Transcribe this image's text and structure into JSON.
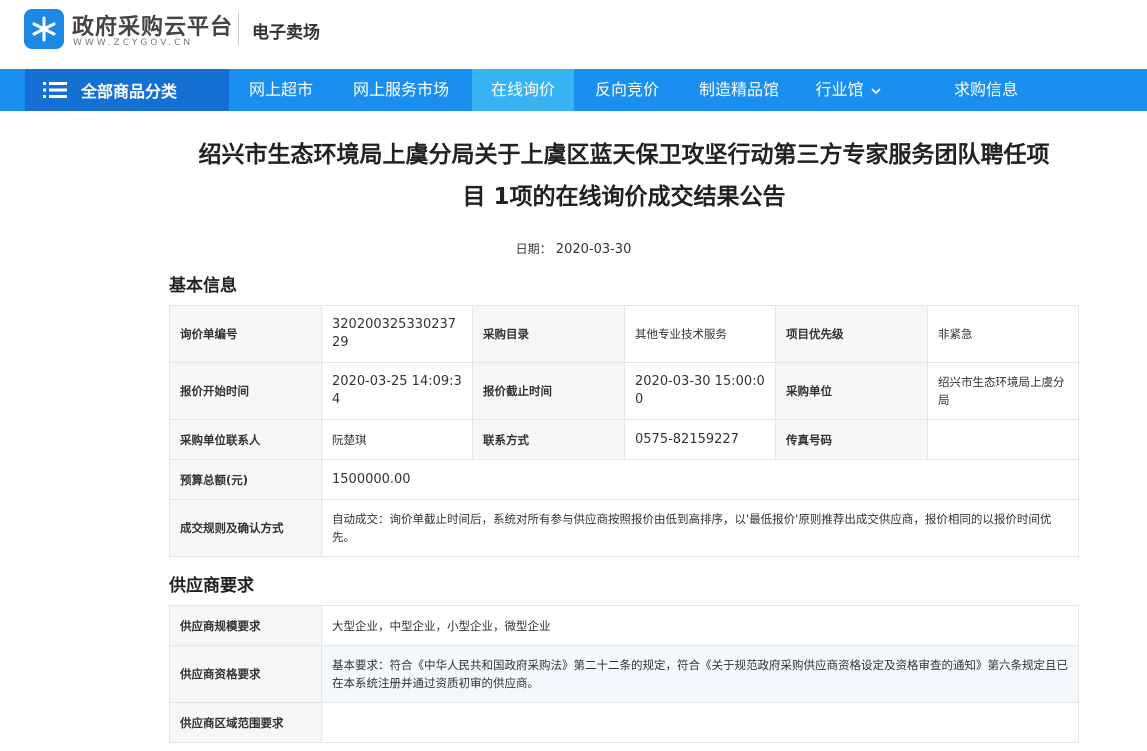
{
  "header": {
    "logo_title": "政府采购云平台",
    "logo_sub": "WWW.ZCYGOV.CN",
    "market": "电子卖场"
  },
  "nav": {
    "all_label": "全部商品分类",
    "items": [
      {
        "label": "网上超市"
      },
      {
        "label": "网上服务市场"
      },
      {
        "label": "在线询价"
      },
      {
        "label": "反向竞价"
      },
      {
        "label": "制造精品馆"
      },
      {
        "label": "行业馆"
      },
      {
        "label": "求购信息"
      }
    ]
  },
  "notice": {
    "title_line1": "绍兴市生态环境局上虞分局关于上虞区蓝天保卫攻坚行动第三方专家服务团队聘任项",
    "title_line2": "目 1项的在线询价成交结果公告",
    "date_label": "日期：",
    "date": "2020-03-30"
  },
  "basic": {
    "heading": "基本信息",
    "inquiry_no_label": "询价单编号",
    "inquiry_no": "32020032533023729",
    "catalog_label": "采购目录",
    "catalog": "其他专业技术服务",
    "priority_label": "项目优先级",
    "priority": "非紧急",
    "start_label": "报价开始时间",
    "start": "2020-03-25 14:09:34",
    "end_label": "报价截止时间",
    "end": "2020-03-30 15:00:00",
    "buyer_label": "采购单位",
    "buyer": "绍兴市生态环境局上虞分局",
    "contact_label": "采购单位联系人",
    "contact": "阮楚琪",
    "phone_label": "联系方式",
    "phone": "0575-82159227",
    "fax_label": "传真号码",
    "fax": "",
    "budget_label": "预算总额(元)",
    "budget": "1500000.00",
    "rule_label": "成交规则及确认方式",
    "rule": "自动成交：询价单截止时间后，系统对所有参与供应商按照报价由低到高排序，以'最低报价'原则推荐出成交供应商，报价相同的以报价时间优先。"
  },
  "supplier": {
    "heading": "供应商要求",
    "scale_label": "供应商规模要求",
    "scale": "大型企业，中型企业，小型企业，微型企业",
    "qual_label": "供应商资格要求",
    "qual": "基本要求：符合《中华人民共和国政府采购法》第二十二条的规定，符合《关于规范政府采购供应商资格设定及资格审查的通知》第六条规定且已在本系统注册并通过资质初审的供应商。",
    "region_label": "供应商区域范围要求",
    "region": ""
  }
}
